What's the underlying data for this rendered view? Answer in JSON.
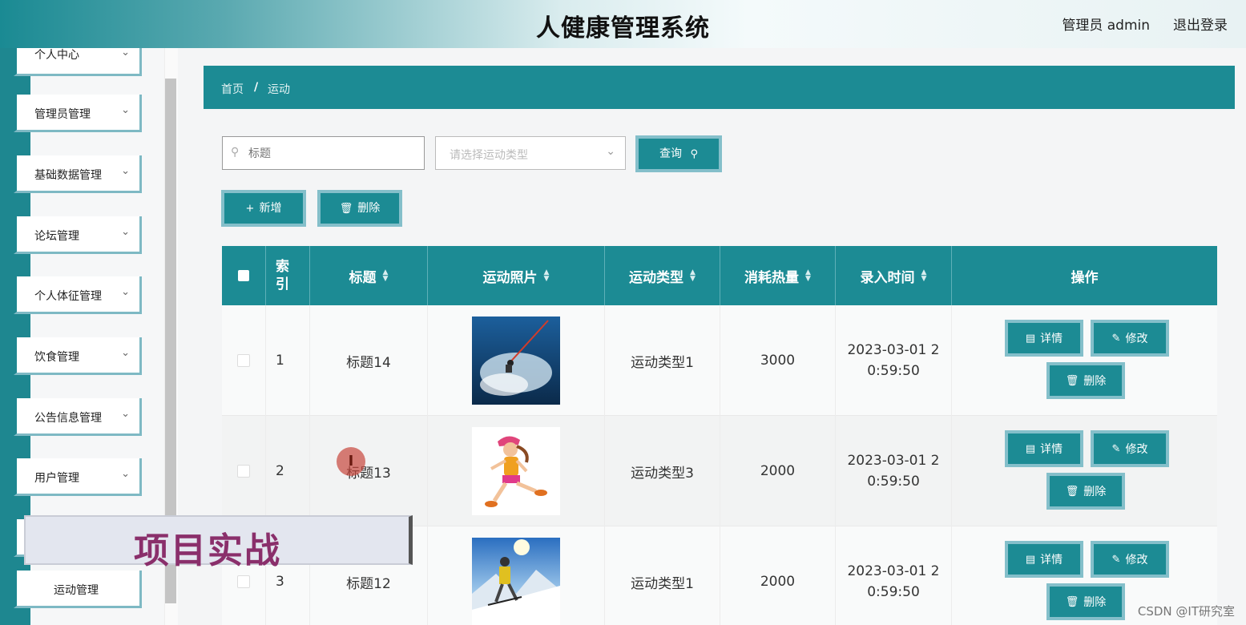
{
  "header": {
    "title": "人健康管理系统",
    "user_label": "管理员 admin",
    "logout_label": "退出登录"
  },
  "sidebar": {
    "items": [
      {
        "label": "个人中心"
      },
      {
        "label": "管理员管理"
      },
      {
        "label": "基础数据管理"
      },
      {
        "label": "论坛管理"
      },
      {
        "label": "个人体征管理"
      },
      {
        "label": "饮食管理"
      },
      {
        "label": "公告信息管理"
      },
      {
        "label": "用户管理"
      },
      {
        "label": "运动管理"
      }
    ]
  },
  "breadcrumb": {
    "home": "首页",
    "separator": "/",
    "current": "运动"
  },
  "search": {
    "title_placeholder": "标题",
    "type_placeholder": "请选择运动类型",
    "query_label": "查询"
  },
  "toolbar": {
    "add_label": "新增",
    "delete_label": "删除"
  },
  "table": {
    "headers": {
      "index": "索引",
      "title": "标题",
      "photo": "运动照片",
      "type": "运动类型",
      "calories": "消耗热量",
      "time": "录入时间",
      "actions": "操作"
    },
    "rows": [
      {
        "index": "1",
        "title": "标题14",
        "type": "运动类型1",
        "calories": "3000",
        "time": "2023-03-01 20:59:50"
      },
      {
        "index": "2",
        "title": "标题13",
        "type": "运动类型3",
        "calories": "2000",
        "time": "2023-03-01 20:59:50"
      },
      {
        "index": "3",
        "title": "标题12",
        "type": "运动类型1",
        "calories": "2000",
        "time": "2023-03-01 20:59:50"
      }
    ],
    "row_actions": {
      "detail": "详情",
      "edit": "修改",
      "delete": "删除"
    }
  },
  "overlay": {
    "banner_text": "项目实战",
    "cursor_glyph": "I"
  },
  "watermark": "CSDN @IT研究室",
  "colors": {
    "primary": "#1c8b94",
    "accent_border": "#84bfca",
    "banner_text": "#8a2f6b"
  }
}
